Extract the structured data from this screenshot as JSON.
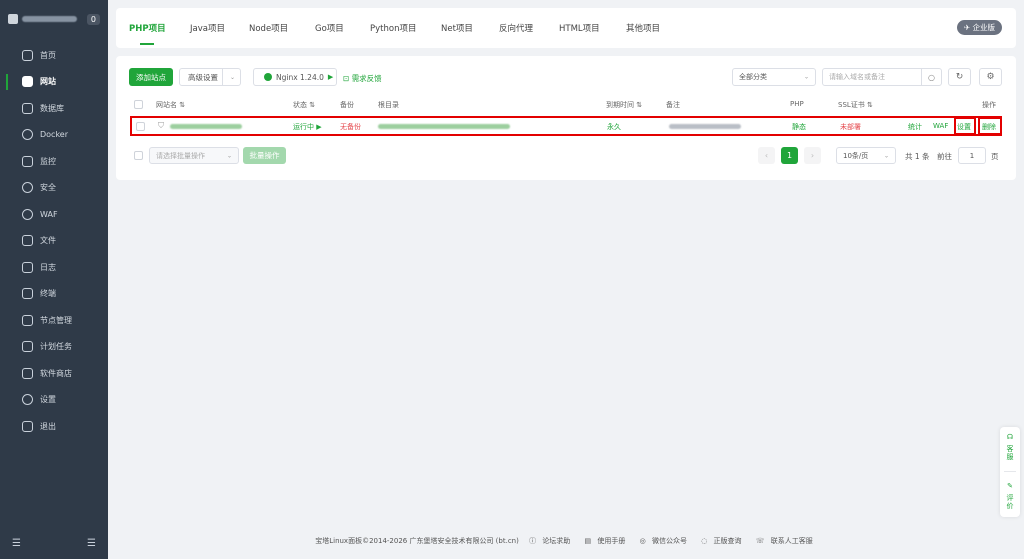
{
  "sidebar": {
    "count": "0",
    "items": [
      {
        "label": "首页",
        "icon": "home-icon"
      },
      {
        "label": "网站",
        "icon": "website-icon"
      },
      {
        "label": "数据库",
        "icon": "database-icon"
      },
      {
        "label": "Docker",
        "icon": "docker-icon"
      },
      {
        "label": "监控",
        "icon": "monitor-icon"
      },
      {
        "label": "安全",
        "icon": "shield-icon"
      },
      {
        "label": "WAF",
        "icon": "waf-icon"
      },
      {
        "label": "文件",
        "icon": "folder-icon"
      },
      {
        "label": "日志",
        "icon": "log-icon"
      },
      {
        "label": "终端",
        "icon": "terminal-icon"
      },
      {
        "label": "节点管理",
        "icon": "node-icon"
      },
      {
        "label": "计划任务",
        "icon": "calendar-icon"
      },
      {
        "label": "软件商店",
        "icon": "store-icon"
      },
      {
        "label": "设置",
        "icon": "gear-icon"
      },
      {
        "label": "退出",
        "icon": "logout-icon"
      }
    ],
    "active": "网站"
  },
  "tabs": [
    "PHP项目",
    "Java项目",
    "Node项目",
    "Go项目",
    "Python项目",
    "Net项目",
    "反向代理",
    "HTML项目",
    "其他项目"
  ],
  "enterprise_badge": "企业版",
  "toolbar": {
    "add_site": "添加站点",
    "advanced": "高级设置",
    "nginx": "Nginx 1.24.0",
    "feedback": "需求反馈",
    "category": "全部分类",
    "search_placeholder": "请输入域名或备注"
  },
  "table": {
    "headers": {
      "name": "网站名",
      "status": "状态",
      "backup": "备份",
      "root": "根目录",
      "expire": "到期时间",
      "remark": "备注",
      "php": "PHP",
      "ssl": "SSL证书",
      "ops": "操作"
    },
    "row": {
      "status": "运行中",
      "backup": "无备份",
      "expire": "永久",
      "php": "静态",
      "ssl": "未部署",
      "stats": "统计",
      "waf": "WAF",
      "settings": "设置",
      "delete": "删除"
    }
  },
  "bulk": {
    "select_placeholder": "请选择批量操作",
    "button": "批量操作"
  },
  "pagination": {
    "current": "1",
    "per_page": "10条/页",
    "total": "共 1 条",
    "goto": "前往",
    "page_input": "1",
    "page_suffix": "页"
  },
  "footer": {
    "copyright": "宝塔Linux面板©2014-2026 广东堡塔安全技术有限公司 (bt.cn)",
    "links": [
      "论坛求助",
      "使用手册",
      "微信公众号",
      "正版查询",
      "联系人工客服"
    ]
  },
  "float": {
    "service": "客服",
    "review": "评价"
  },
  "colors": {
    "accent": "#20a53a",
    "sidebar_bg": "#2f3a48",
    "highlight": "#e30000",
    "danger": "#e5484d"
  }
}
